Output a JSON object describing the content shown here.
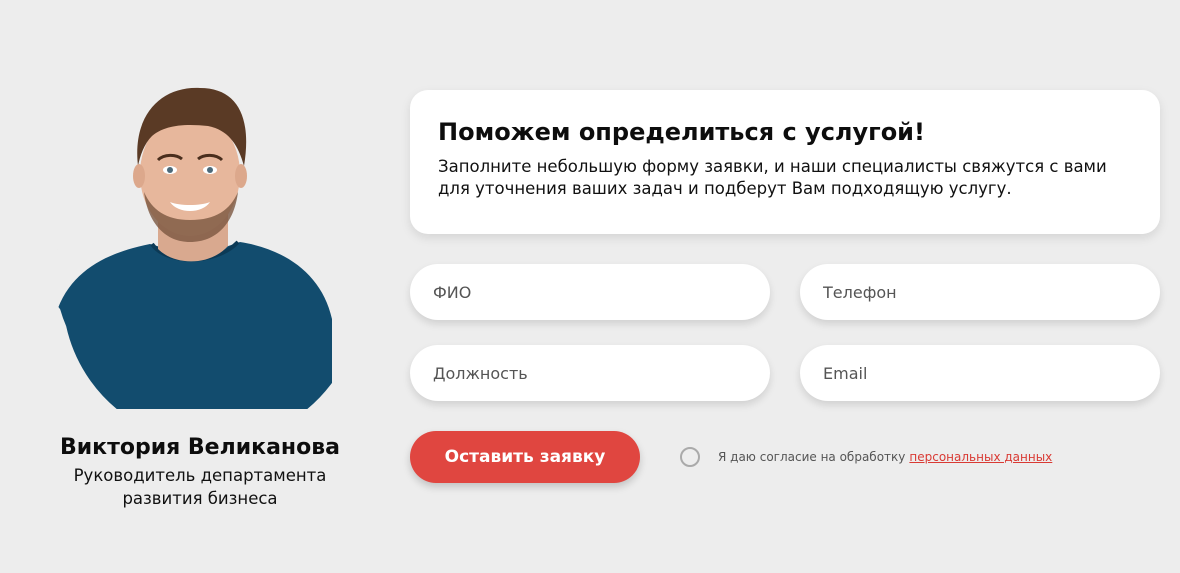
{
  "person": {
    "name": "Виктория Великанова",
    "role_line1": "Руководитель департамента",
    "role_line2": "развития бизнеса"
  },
  "info": {
    "title": "Поможем определиться с услугой!",
    "text": "Заполните небольшую форму заявки, и наши специалисты свяжутся с вами для уточнения ваших задач и подберут Вам подходящую услугу."
  },
  "form": {
    "fio_placeholder": "ФИО",
    "phone_placeholder": "Телефон",
    "position_placeholder": "Должность",
    "email_placeholder": "Email",
    "fio_value": "",
    "phone_value": "",
    "position_value": "",
    "email_value": "",
    "submit_label": "Оставить заявку",
    "consent_text": "Я даю согласие на обработку",
    "consent_link": "персональных данных",
    "consent_checked": false
  },
  "colors": {
    "background": "#ededed",
    "accent": "#e04640",
    "link": "#d93a34",
    "card": "#ffffff"
  }
}
